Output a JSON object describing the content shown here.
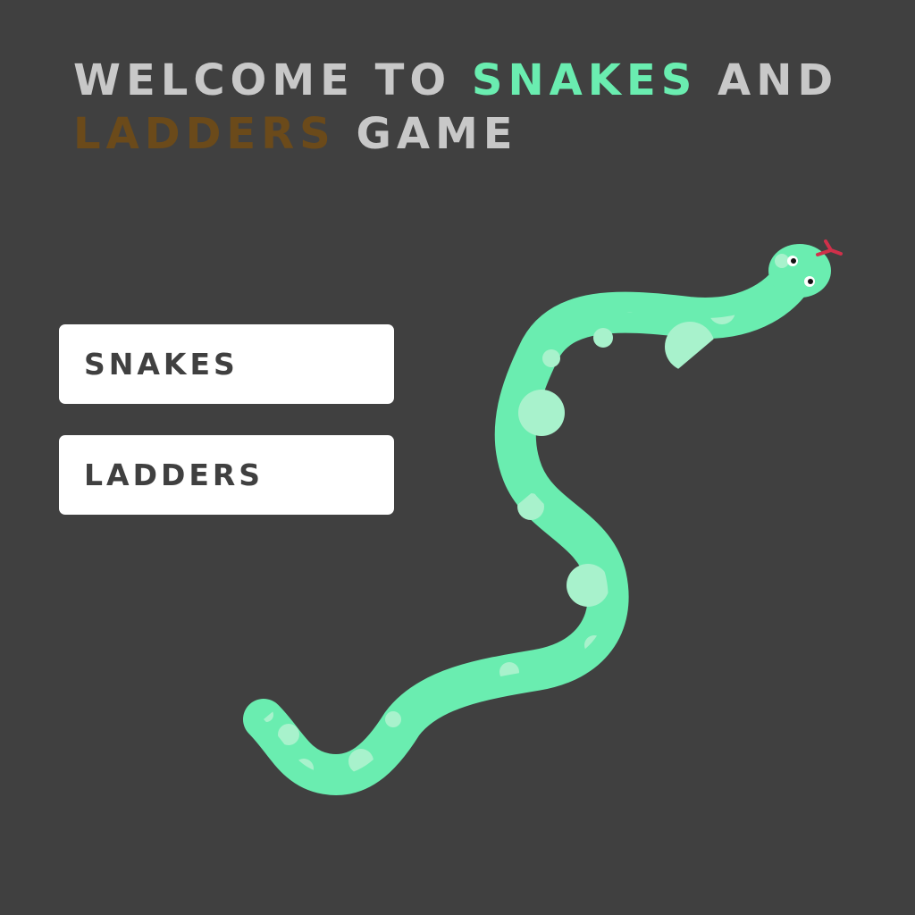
{
  "title": {
    "part1": "WELCOME TO ",
    "snakes": "SNAKES",
    "part2": " AND ",
    "ladders": "LADDERS",
    "part3": " GAME"
  },
  "menu": {
    "snakes_label": "SNAKES",
    "ladders_label": "LADDERS"
  },
  "colors": {
    "background": "#404040",
    "title_text": "#c8c8c8",
    "snakes_accent": "#6aedb0",
    "ladders_accent": "#6b4a1a",
    "button_bg": "#ffffff",
    "button_text": "#404040",
    "snake_body": "#6aedb0",
    "snake_spots": "#a8f2cc",
    "snake_tongue": "#d0304a"
  }
}
